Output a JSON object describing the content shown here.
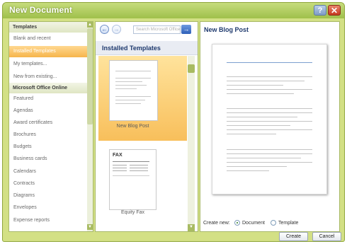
{
  "window": {
    "title": "New Document",
    "help_glyph": "?",
    "close_glyph": "✕"
  },
  "sidebar": {
    "header": "Templates",
    "items": [
      {
        "label": "Blank and recent",
        "selected": false
      },
      {
        "label": "Installed Templates",
        "selected": true
      },
      {
        "label": "My templates...",
        "selected": false
      },
      {
        "label": "New from existing...",
        "selected": false
      }
    ],
    "online_header": "Microsoft Office Online",
    "online_items": [
      "Featured",
      "Agendas",
      "Award certificates",
      "Brochures",
      "Budgets",
      "Business cards",
      "Calendars",
      "Contracts",
      "Diagrams",
      "Envelopes",
      "Expense reports"
    ]
  },
  "middle": {
    "search_placeholder": "Search Microsoft Office Online",
    "heading": "Installed Templates",
    "templates": [
      {
        "label": "New Blog Post",
        "selected": true
      },
      {
        "label": "Equity Fax",
        "thumb_text": "FAX"
      }
    ]
  },
  "preview": {
    "title": "New Blog Post",
    "create_new_label": "Create new:",
    "options": [
      {
        "label": "Document",
        "checked": true
      },
      {
        "label": "Template",
        "checked": false
      }
    ]
  },
  "buttons": {
    "create": "Create",
    "cancel": "Cancel"
  },
  "colors": {
    "frame": "#d3e085",
    "selection": "#f8bf5b",
    "heading_blue": "#1f3a6e"
  }
}
